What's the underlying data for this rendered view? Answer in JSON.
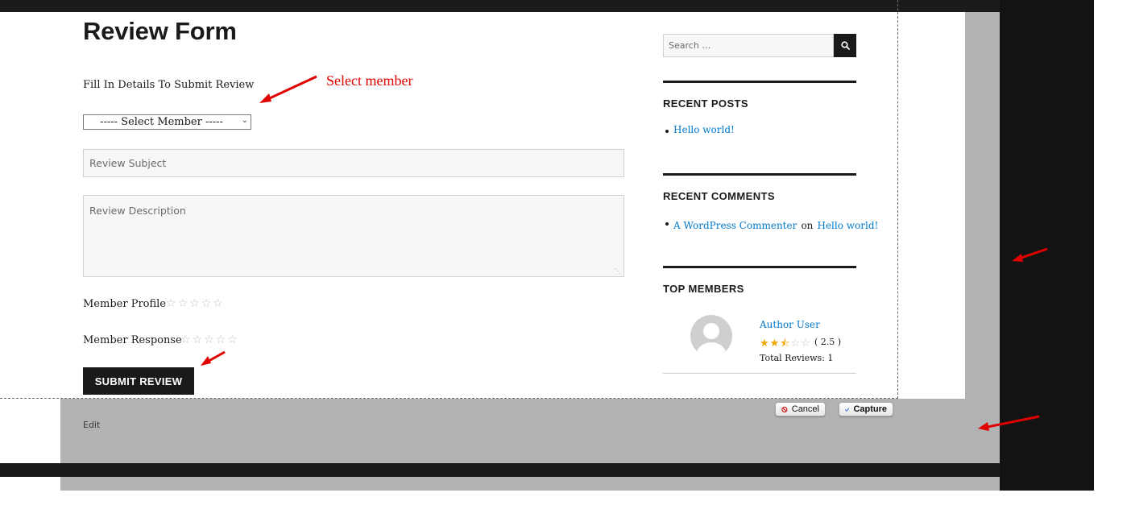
{
  "page": {
    "title": "Review Form",
    "intro": "Fill In Details To Submit Review"
  },
  "form": {
    "member_select": {
      "value": "----- Select Member -----"
    },
    "subject": {
      "placeholder": "Review Subject",
      "value": ""
    },
    "description": {
      "placeholder": "Review Description",
      "value": ""
    },
    "ratings": [
      {
        "label": "Member Profile",
        "stars": 0,
        "max": 5
      },
      {
        "label": "Member Response",
        "stars": 0,
        "max": 5
      }
    ],
    "submit_label": "SUBMIT REVIEW"
  },
  "sidebar": {
    "search": {
      "placeholder": "Search …"
    },
    "recent_posts": {
      "title": "RECENT POSTS",
      "items": [
        {
          "label": "Hello world!"
        }
      ]
    },
    "recent_comments": {
      "title": "RECENT COMMENTS",
      "items": [
        {
          "author": "A WordPress Commenter",
          "connector": "on",
          "post": "Hello world!"
        }
      ]
    },
    "top_members": {
      "title": "TOP MEMBERS",
      "items": [
        {
          "name": "Author User",
          "rating": 2.5,
          "rating_text": "( 2.5 )",
          "total_reviews": "Total Reviews: 1"
        }
      ]
    }
  },
  "footer": {
    "edit_label": "Edit"
  },
  "capture_toolbar": {
    "cancel_label": "Cancel",
    "capture_label": "Capture"
  },
  "annotations": {
    "select_member_note": "Select member"
  },
  "colors": {
    "link": "#007acc",
    "button_dark": "#1a1a1a",
    "annotation_red": "#e00000",
    "star_gold": "#f0a800"
  },
  "icons": [
    "search-icon",
    "star-icon",
    "avatar-icon",
    "cancel-icon",
    "checkmark-icon",
    "chevron-down-icon"
  ]
}
